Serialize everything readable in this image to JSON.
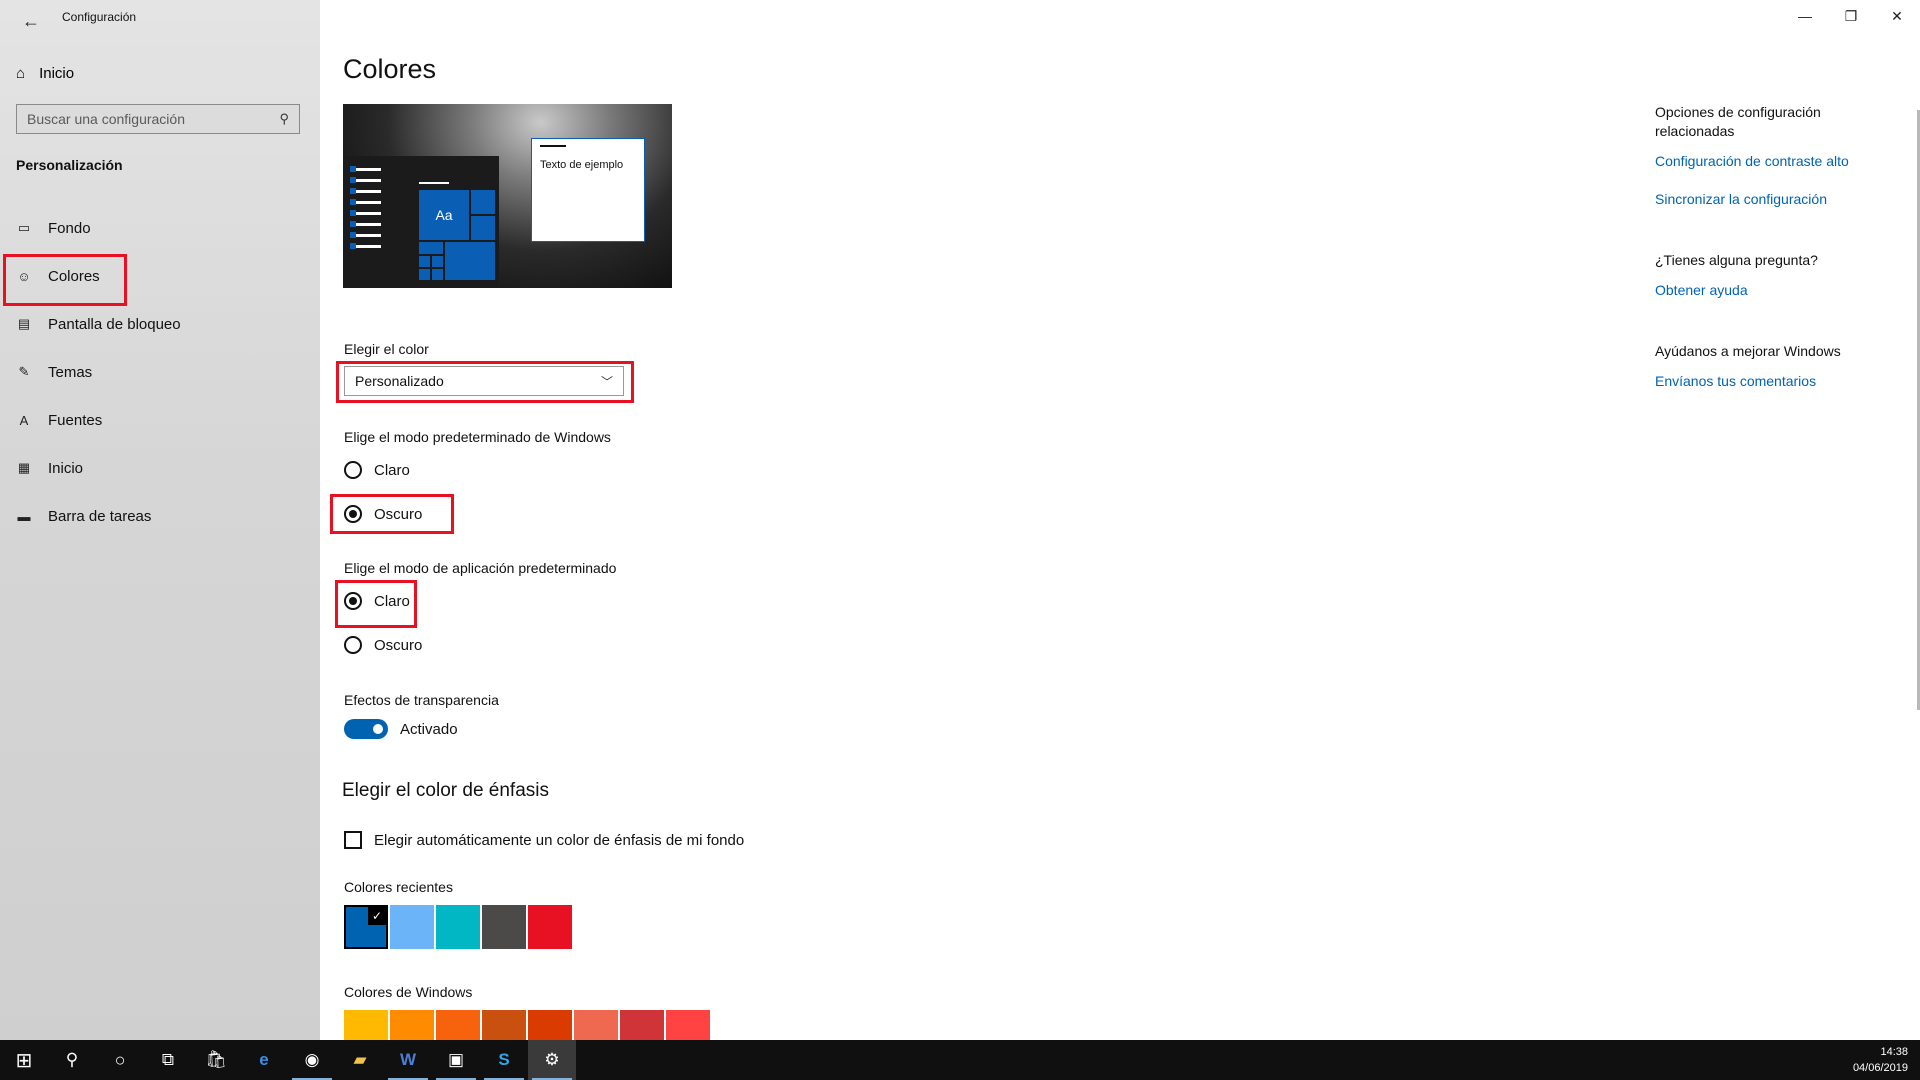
{
  "window": {
    "title": "Configuración",
    "controls": [
      "—",
      "❐",
      "✕"
    ]
  },
  "sidebar": {
    "home": "Inicio",
    "search_placeholder": "Buscar una configuración",
    "section": "Personalización",
    "items": [
      {
        "label": "Fondo",
        "icon": "image-icon",
        "glyph": "▭"
      },
      {
        "label": "Colores",
        "icon": "palette-icon",
        "glyph": "☺"
      },
      {
        "label": "Pantalla de bloqueo",
        "icon": "lock-screen-icon",
        "glyph": "▤"
      },
      {
        "label": "Temas",
        "icon": "themes-icon",
        "glyph": "✎"
      },
      {
        "label": "Fuentes",
        "icon": "fonts-icon",
        "glyph": "A"
      },
      {
        "label": "Inicio",
        "icon": "start-icon",
        "glyph": "▦"
      },
      {
        "label": "Barra de tareas",
        "icon": "taskbar-icon",
        "glyph": "▬"
      }
    ],
    "selected_index": 1
  },
  "main": {
    "title": "Colores",
    "preview_text": "Texto de ejemplo",
    "preview_tile": "Aa",
    "choose_color": {
      "label": "Elegir el color",
      "value": "Personalizado"
    },
    "windows_mode": {
      "label": "Elige el modo predeterminado de Windows",
      "options": [
        "Claro",
        "Oscuro"
      ],
      "selected": "Oscuro"
    },
    "app_mode": {
      "label": "Elige el modo de aplicación predeterminado",
      "options": [
        "Claro",
        "Oscuro"
      ],
      "selected": "Claro"
    },
    "transparency": {
      "label": "Efectos de transparencia",
      "state": "Activado"
    },
    "accent": {
      "title": "Elegir el color de énfasis",
      "auto_label": "Elegir automáticamente un color de énfasis de mi fondo",
      "recent_label": "Colores recientes",
      "recent_colors": [
        "#0063b1",
        "#6cb4f8",
        "#00b7c3",
        "#4c4a48",
        "#e81123"
      ],
      "windows_label": "Colores de Windows",
      "windows_colors": [
        "#ffb900",
        "#ff8c00",
        "#f7630c",
        "#ca5010",
        "#da3b01",
        "#ef6950",
        "#d13438",
        "#ff4343"
      ]
    }
  },
  "related": {
    "heading1": "Opciones de configuración relacionadas",
    "link1": "Configuración de contraste alto",
    "link2": "Sincronizar la configuración",
    "heading2": "¿Tienes alguna pregunta?",
    "link3": "Obtener ayuda",
    "heading3": "Ayúdanos a mejorar Windows",
    "link4": "Envíanos tus comentarios"
  },
  "taskbar": {
    "time": "14:38",
    "date": "04/06/2019"
  }
}
